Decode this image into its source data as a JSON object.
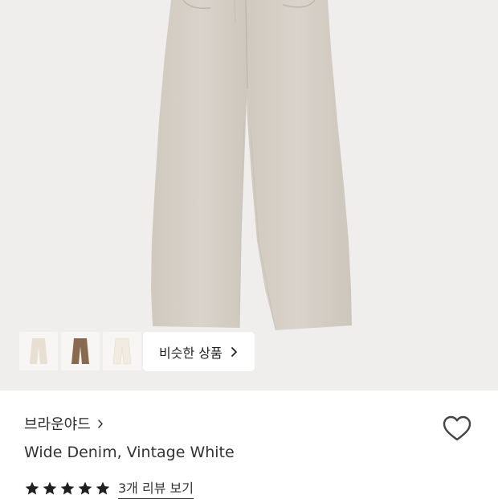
{
  "product": {
    "brand": "브라운야드",
    "name": "Wide Denim, Vintage White",
    "rating_stars": 5,
    "review_link": "3개 리뷰 보기"
  },
  "gallery": {
    "similar_button_label": "비슷한 상품",
    "thumbnails": [
      {
        "color_name": "vintage-white",
        "color": "#e6dfd2"
      },
      {
        "color_name": "brown",
        "color": "#8a6a4e"
      },
      {
        "color_name": "ivory",
        "color": "#f1ebe2"
      }
    ]
  },
  "colors": {
    "pants": "#d7d2c9",
    "hero_bg": "#efeeec",
    "star": "#1f1f1f"
  },
  "icons": {
    "heart": "heart-icon",
    "chevron": "chevron-right-icon",
    "star": "star-icon"
  }
}
